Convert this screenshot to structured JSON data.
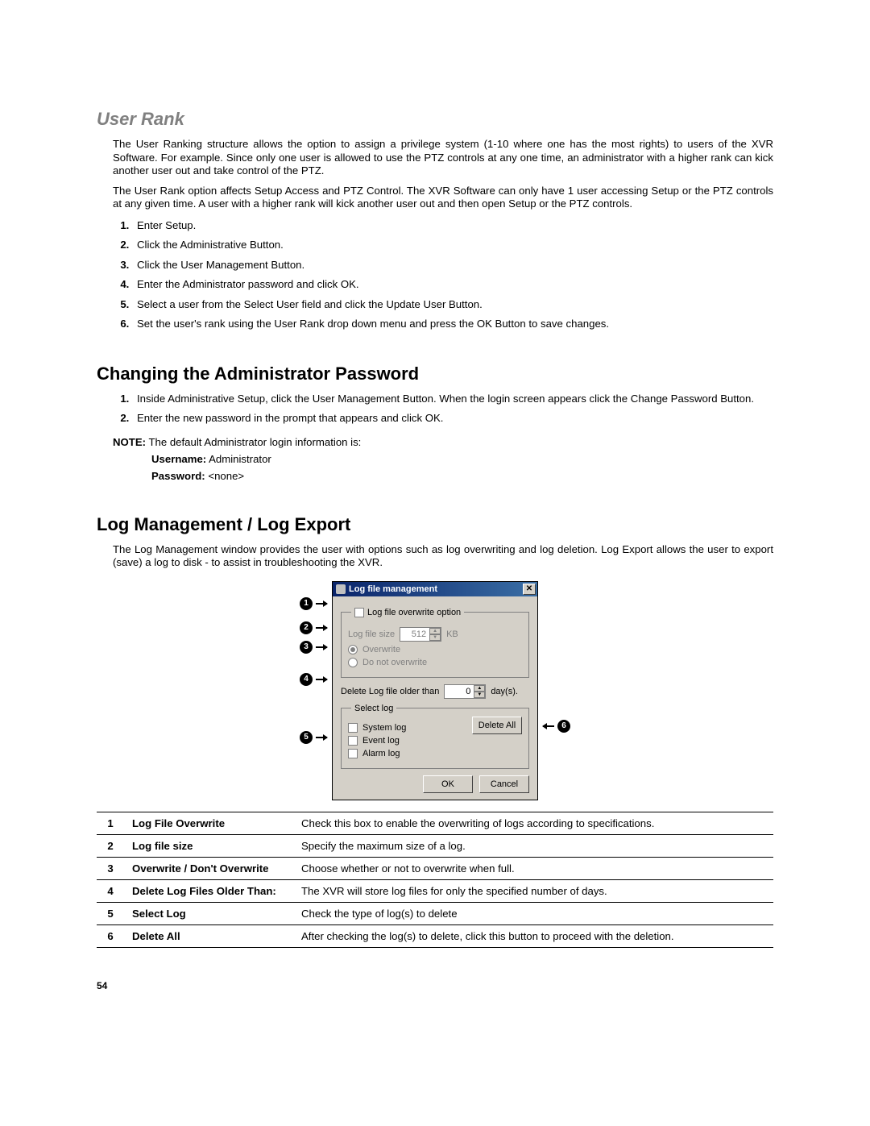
{
  "section1": {
    "heading": "User Rank",
    "para1": "The User Ranking structure allows the option to assign a privilege system (1-10 where one has the most rights) to users of the XVR Software.  For example.  Since only one user is allowed to use the PTZ controls at any one time, an administrator with a higher rank can kick another user out and take control of the PTZ.",
    "para2": "The User Rank option affects Setup Access and PTZ Control.  The XVR Software can only have 1 user accessing Setup or the PTZ controls at any given time.  A user with a higher rank will kick another user out and then open Setup or the PTZ controls.",
    "steps": [
      "Enter Setup.",
      "Click the Administrative Button.",
      "Click the User Management Button.",
      "Enter the Administrator password and click OK.",
      "Select a user from the Select User field and click the Update User Button.",
      "Set the user's rank using the User Rank drop down menu and press the OK Button to save  changes."
    ]
  },
  "section2": {
    "heading": "Changing the Administrator Password",
    "steps": [
      "Inside Administrative Setup, click the User Management Button. When the login screen appears click the Change Password Button.",
      "Enter the new password in the prompt that appears and click OK."
    ],
    "note_label": "NOTE:",
    "note_text": " The default Administrator login information is:",
    "username_label": "Username:",
    "username_value": " Administrator",
    "password_label": "Password:",
    "password_value": " <none>"
  },
  "section3": {
    "heading": "Log Management / Log Export",
    "para": "The Log Management window provides the user with options such as log overwriting and log deletion. Log Export allows the user to export (save) a log to disk - to assist in troubleshooting the XVR."
  },
  "dialog": {
    "title": "Log file management",
    "overwrite_legend": "Log file overwrite option",
    "logfile_size_label": "Log file size",
    "logfile_size_value": "512",
    "kb_label": "KB",
    "overwrite_radio": "Overwrite",
    "donot_overwrite_radio": "Do not overwrite",
    "delete_older_label": "Delete Log file older than",
    "delete_older_value": "0",
    "days_label": "day(s).",
    "select_log_legend": "Select log",
    "system_log": "System log",
    "event_log": "Event log",
    "alarm_log": "Alarm log",
    "delete_all_btn": "Delete All",
    "ok_btn": "OK",
    "cancel_btn": "Cancel"
  },
  "callouts": [
    "1",
    "2",
    "3",
    "4",
    "5",
    "6"
  ],
  "table": {
    "rows": [
      {
        "num": "1",
        "name": "Log File Overwrite",
        "desc": "Check this box to enable the overwriting of logs according to specifications."
      },
      {
        "num": "2",
        "name": "Log file size",
        "desc": "Specify the maximum size of a log."
      },
      {
        "num": "3",
        "name": "Overwrite / Don't Overwrite",
        "desc": "Choose whether or not to overwrite when full."
      },
      {
        "num": "4",
        "name": "Delete Log Files Older Than:",
        "desc": "The XVR will store log files for only the specified number of days."
      },
      {
        "num": "5",
        "name": "Select Log",
        "desc": "Check the type of log(s) to delete"
      },
      {
        "num": "6",
        "name": "Delete All",
        "desc": "After checking the log(s) to delete, click this button to proceed with the deletion."
      }
    ]
  },
  "page_number": "54"
}
